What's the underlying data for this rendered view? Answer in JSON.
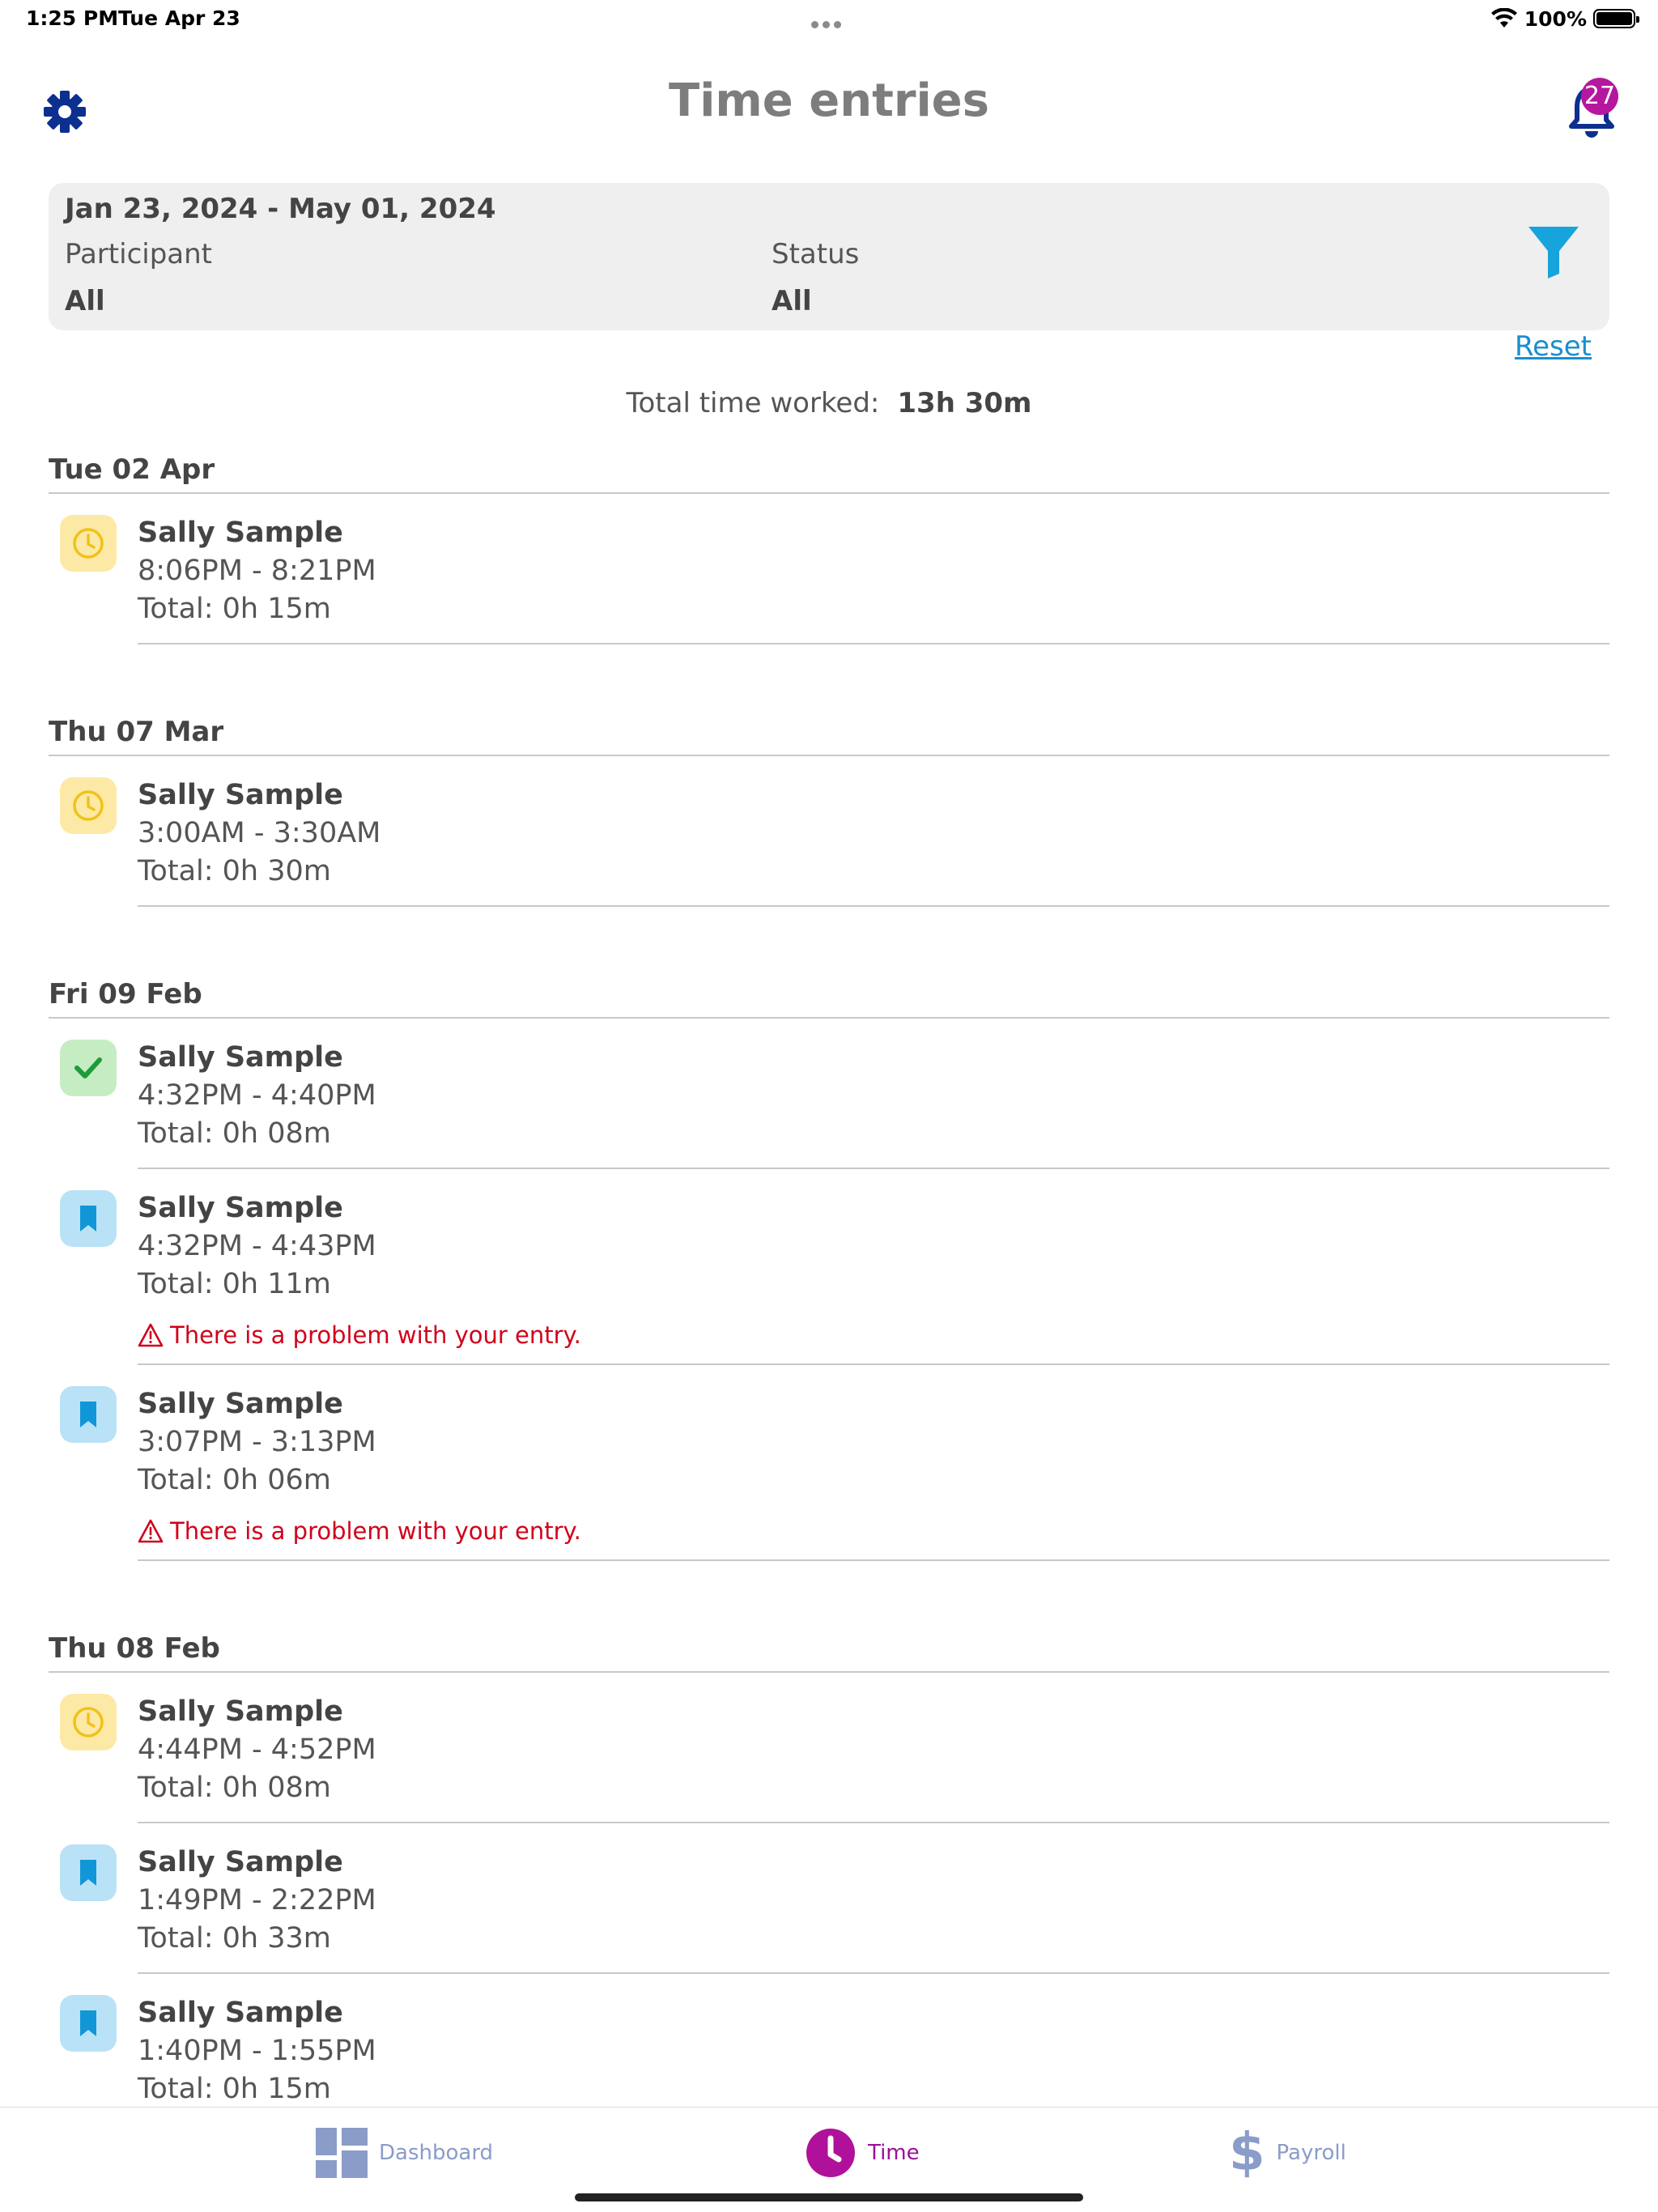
{
  "status_bar": {
    "time": "1:25 PM",
    "date": "Tue Apr 23",
    "battery": "100%"
  },
  "header": {
    "title": "Time entries",
    "notification_count": "27",
    "accent_color": "#0d2f8f"
  },
  "filter": {
    "date_range": "Jan 23, 2024 - May 01, 2024",
    "participant_label": "Participant",
    "participant_value": "All",
    "status_label": "Status",
    "status_value": "All",
    "reset_label": "Reset"
  },
  "summary": {
    "label": "Total time worked:",
    "value": "13h 30m"
  },
  "groups": [
    {
      "date": "Tue 02 Apr",
      "entries": [
        {
          "status_icon": "clock-icon",
          "name": "Sally Sample",
          "time": "8:06PM - 8:21PM",
          "total": "Total: 0h 15m",
          "warning": ""
        }
      ]
    },
    {
      "date": "Thu 07 Mar",
      "entries": [
        {
          "status_icon": "clock-icon",
          "name": "Sally Sample",
          "time": "3:00AM - 3:30AM",
          "total": "Total: 0h 30m",
          "warning": ""
        }
      ]
    },
    {
      "date": "Fri 09 Feb",
      "entries": [
        {
          "status_icon": "check-icon",
          "name": "Sally Sample",
          "time": "4:32PM - 4:40PM",
          "total": "Total: 0h 08m",
          "warning": ""
        },
        {
          "status_icon": "bookmark-icon",
          "name": "Sally Sample",
          "time": "4:32PM - 4:43PM",
          "total": "Total: 0h 11m",
          "warning": "There is a problem with your entry."
        },
        {
          "status_icon": "bookmark-icon",
          "name": "Sally Sample",
          "time": "3:07PM - 3:13PM",
          "total": "Total: 0h 06m",
          "warning": "There is a problem with your entry."
        }
      ]
    },
    {
      "date": "Thu 08 Feb",
      "entries": [
        {
          "status_icon": "clock-icon",
          "name": "Sally Sample",
          "time": "4:44PM - 4:52PM",
          "total": "Total: 0h 08m",
          "warning": ""
        },
        {
          "status_icon": "bookmark-icon",
          "name": "Sally Sample",
          "time": "1:49PM - 2:22PM",
          "total": "Total: 0h 33m",
          "warning": ""
        },
        {
          "status_icon": "bookmark-icon",
          "name": "Sally Sample",
          "time": "1:40PM - 1:55PM",
          "total": "Total: 0h 15m",
          "warning": ""
        }
      ]
    }
  ],
  "tabs": [
    {
      "label": "Dashboard",
      "icon": "dashboard-icon"
    },
    {
      "label": "Time",
      "icon": "clock-icon"
    },
    {
      "label": "Payroll",
      "icon": "dollar-icon"
    }
  ]
}
